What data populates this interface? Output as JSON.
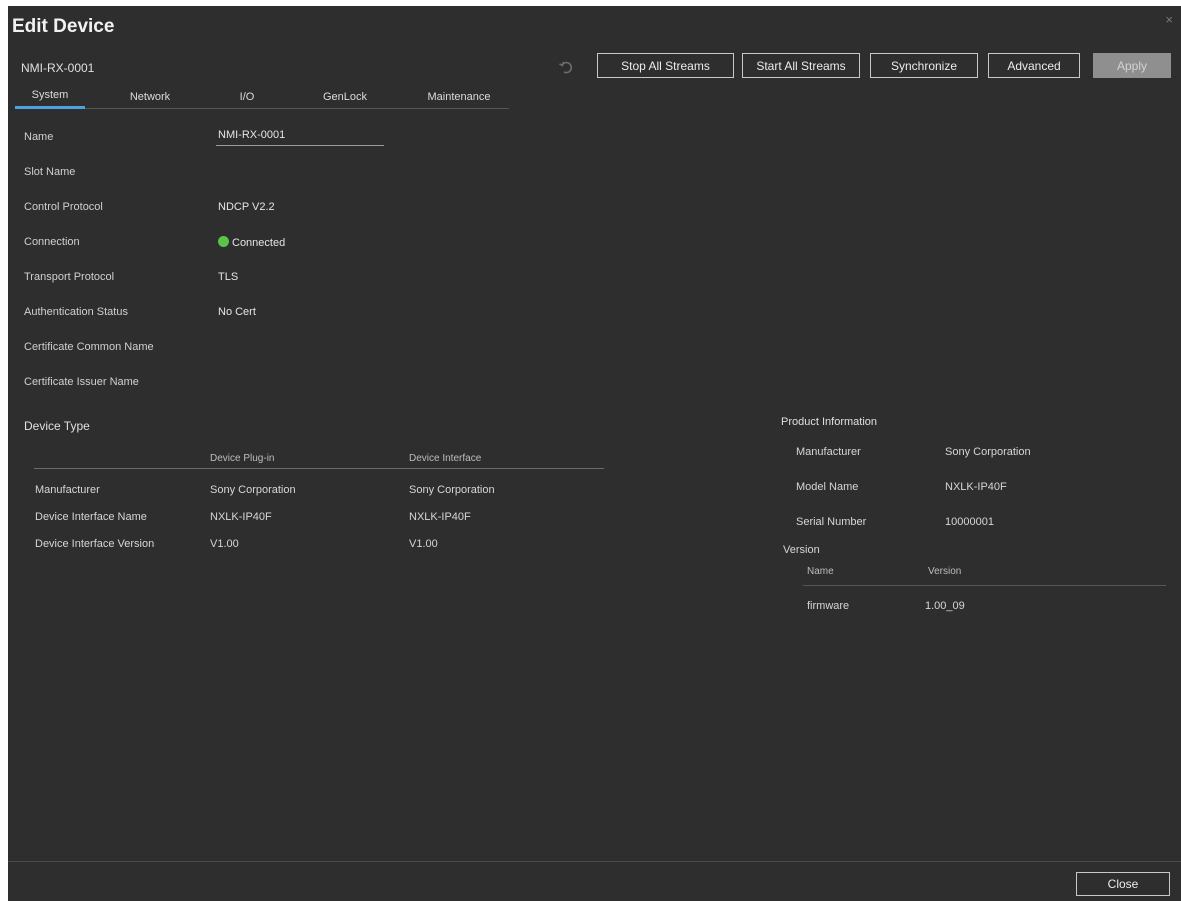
{
  "dialog": {
    "title": "Edit Device",
    "close_glyph": "×"
  },
  "device_id": "NMI-RX-0001",
  "toolbar": {
    "undo_icon": "undo-icon",
    "stop_all": "Stop All Streams",
    "start_all": "Start All Streams",
    "synchronize": "Synchronize",
    "advanced": "Advanced",
    "apply": "Apply"
  },
  "tabs": [
    "System",
    "Network",
    "I/O",
    "GenLock",
    "Maintenance"
  ],
  "active_tab": "System",
  "system": {
    "name_label": "Name",
    "name_value": "NMI-RX-0001",
    "slot_label": "Slot Name",
    "protocol_label": "Control Protocol",
    "protocol_value": "NDCP V2.2",
    "connection_label": "Connection",
    "connection_value": "Connected",
    "connection_color": "#5cc24a",
    "transport_label": "Transport Protocol",
    "transport_value": "TLS",
    "auth_label": "Authentication Status",
    "auth_value": "No Cert",
    "cert_common_label": "Certificate Common Name",
    "cert_issuer_label": "Certificate Issuer Name"
  },
  "device_type": {
    "heading": "Device Type",
    "columns": [
      "Device Plug-in",
      "Device Interface"
    ],
    "rows": [
      {
        "label": "Manufacturer",
        "plugin": "Sony Corporation",
        "interface": "Sony Corporation"
      },
      {
        "label": "Device Interface Name",
        "plugin": "NXLK-IP40F",
        "interface": "NXLK-IP40F"
      },
      {
        "label": "Device Interface Version",
        "plugin": "V1.00",
        "interface": "V1.00"
      }
    ]
  },
  "product_info": {
    "heading": "Product Information",
    "manufacturer_label": "Manufacturer",
    "manufacturer_value": "Sony Corporation",
    "model_label": "Model Name",
    "model_value": "NXLK-IP40F",
    "serial_label": "Serial Number",
    "serial_value": "10000001",
    "version_label": "Version",
    "version_table": {
      "columns": [
        "Name",
        "Version"
      ],
      "rows": [
        {
          "name": "firmware",
          "version": "1.00_09"
        }
      ]
    }
  },
  "footer": {
    "close": "Close"
  }
}
